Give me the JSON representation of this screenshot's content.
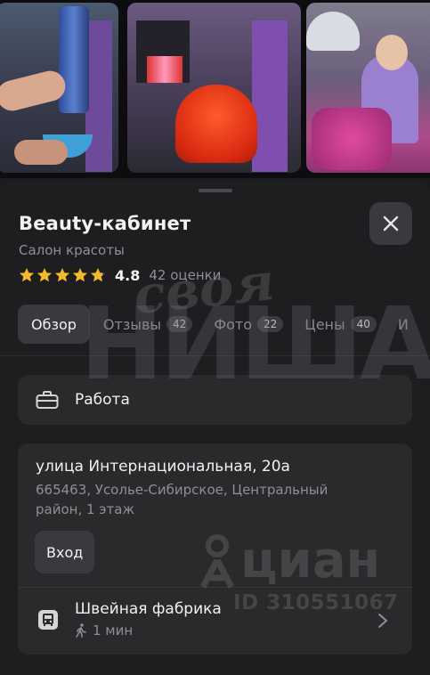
{
  "photos": [
    {
      "alt": "hair-coloring-photo"
    },
    {
      "alt": "red-haircut-photo"
    },
    {
      "alt": "cosmetology-photo"
    }
  ],
  "header": {
    "title": "Beauty-кабинет",
    "category": "Салон красоты",
    "rating": "4.8",
    "rating_fraction": 0.96,
    "rating_count": "42 оценки",
    "close_icon": "close-icon"
  },
  "tabs": [
    {
      "label": "Обзор",
      "active": true
    },
    {
      "label": "Отзывы",
      "count": "42"
    },
    {
      "label": "Фото",
      "count": "22"
    },
    {
      "label": "Цены",
      "count": "40"
    },
    {
      "label": "И"
    }
  ],
  "work_card": {
    "icon": "briefcase-icon",
    "label": "Работа"
  },
  "address_card": {
    "street": "улица Интернациональная, 20а",
    "detail": "665463, Усолье-Сибирское, Центральный район, 1 этаж",
    "entrance_button": "Вход",
    "stop_icon": "bus-stop-icon",
    "stop_name": "Швейная фабрика",
    "walk_icon": "walking-icon",
    "walk_time": "1 мин"
  },
  "watermarks": {
    "top_line": "своя",
    "bottom_line": "НИША",
    "brand": "циан",
    "listing_id": "ID 310551067"
  },
  "colors": {
    "background": "#1b1b1d",
    "sheet": "#1e1e20",
    "card": "#2a2a2d",
    "star": "#f5b92e",
    "text_primary": "#f2f2f4",
    "text_secondary": "#8f8f94"
  }
}
